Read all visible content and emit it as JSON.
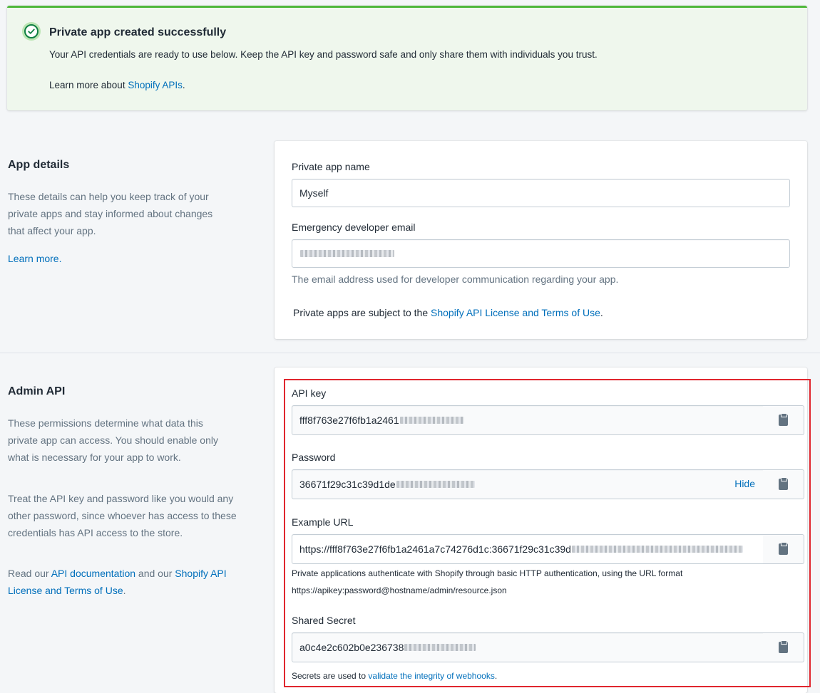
{
  "banner": {
    "title": "Private app created successfully",
    "text": "Your API credentials are ready to use below. Keep the API key and password safe and only share them with individuals you trust.",
    "learn_prefix": "Learn more about ",
    "learn_link": "Shopify APIs",
    "learn_suffix": "."
  },
  "app_details": {
    "title": "App details",
    "desc": "These details can help you keep track of your private apps and stay informed about changes that affect your app.",
    "learn_more": "Learn more.",
    "name_label": "Private app name",
    "name_value": "Myself",
    "email_label": "Emergency developer email",
    "email_help": "The email address used for developer communication regarding your app.",
    "terms_prefix": "Private apps are subject to the ",
    "terms_link": "Shopify API License and Terms of Use",
    "terms_suffix": "."
  },
  "admin_api": {
    "title": "Admin API",
    "desc1": "These permissions determine what data this private app can access. You should enable only what is necessary for your app to work.",
    "desc2": "Treat the API key and password like you would any other password, since whoever has access to these credentials has API access to the store.",
    "read_prefix": "Read our ",
    "read_link1": "API documentation",
    "read_mid": " and our ",
    "read_link2": "Shopify API License and Terms of Use",
    "read_suffix": ".",
    "api_key_label": "API key",
    "api_key_value": "fff8f763e27f6fb1a2461",
    "password_label": "Password",
    "password_value": "36671f29c31c39d1de",
    "hide_label": "Hide",
    "example_url_label": "Example URL",
    "example_url_value": "https://fff8f763e27f6fb1a2461a7c74276d1c:36671f29c31c39d",
    "example_url_help1": "Private applications authenticate with Shopify through basic HTTP authentication, using the URL format",
    "example_url_help2": "https://apikey:password@hostname/admin/resource.json",
    "shared_secret_label": "Shared Secret",
    "shared_secret_value": "a0c4e2c602b0e236738",
    "secret_help_prefix": "Secrets are used to ",
    "secret_help_link": "validate the integrity of webhooks",
    "secret_help_suffix": "."
  },
  "colors": {
    "success_border": "#50b83c",
    "success_bg": "#eff7ed",
    "link": "#006fbb",
    "highlight": "#e0262e"
  }
}
